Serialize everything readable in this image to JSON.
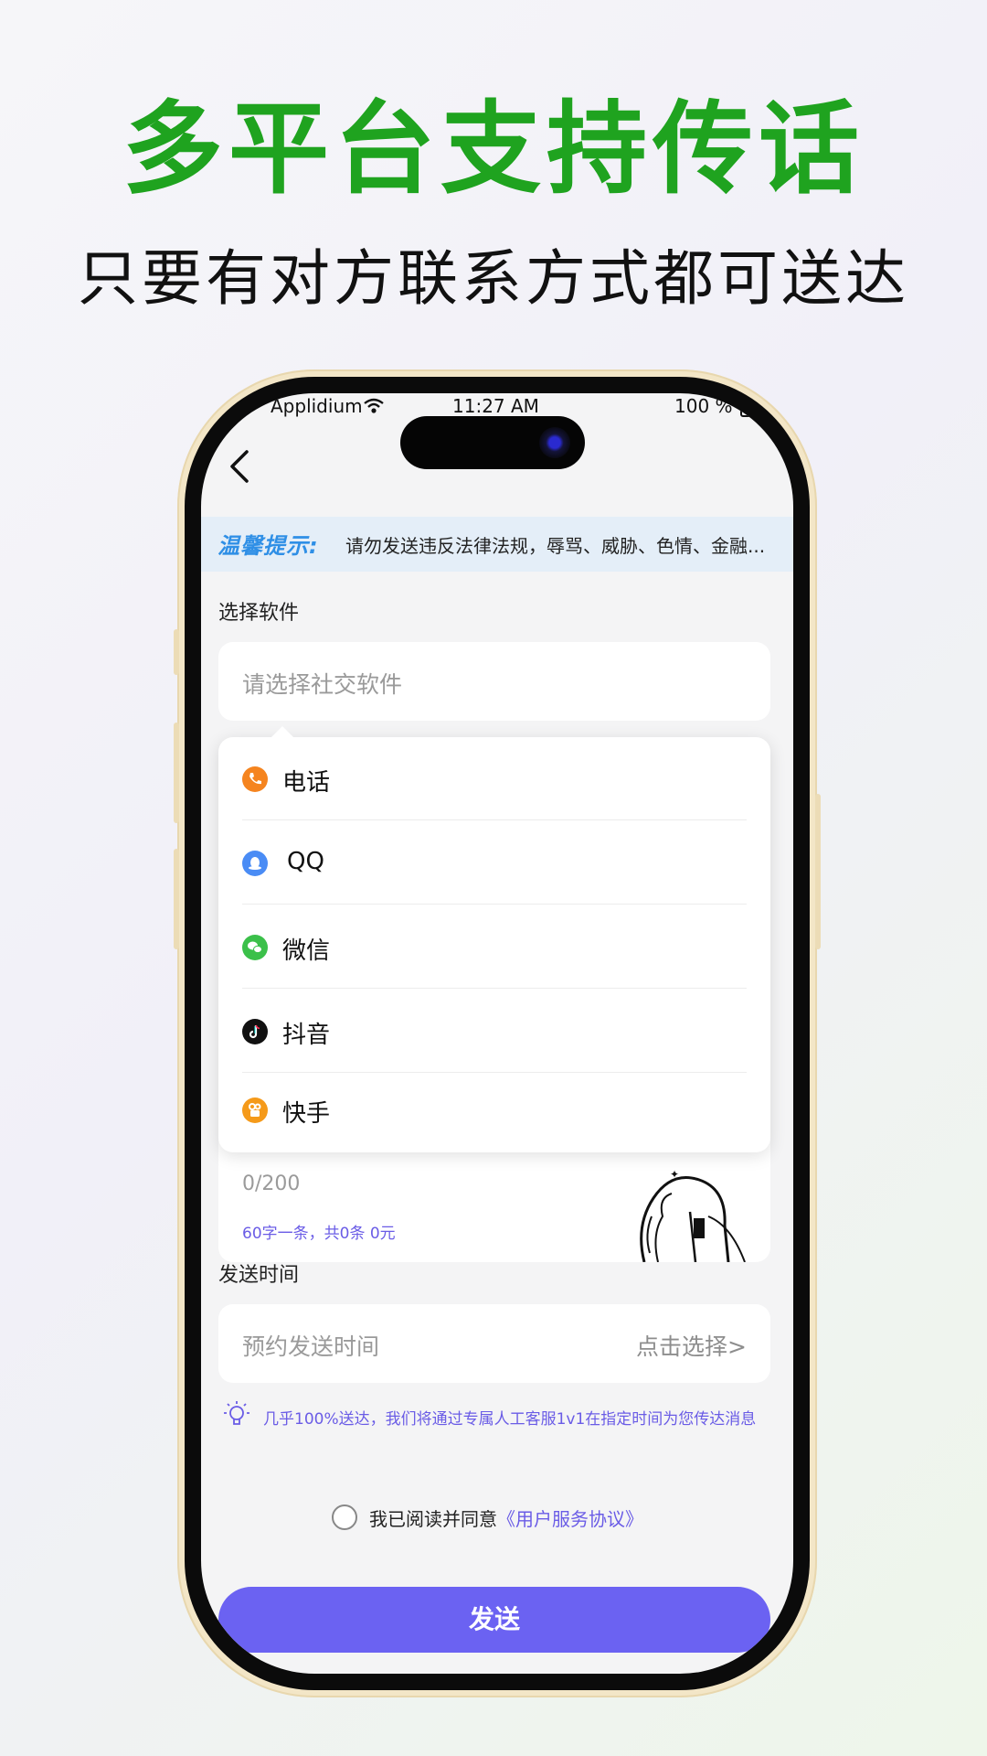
{
  "promo": {
    "headline": "多平台支持传话",
    "subline": "只要有对方联系方式都可送达"
  },
  "status_bar": {
    "carrier": "Applidium",
    "time": "11:27 AM",
    "battery": "100 %"
  },
  "notice": {
    "label": "温馨提示:",
    "text": "请勿发送违反法律法规，辱骂、威胁、色情、金融..."
  },
  "software": {
    "label": "选择软件",
    "placeholder": "请选择社交软件",
    "options": [
      {
        "label": "电话",
        "icon": "phone-icon",
        "color": "#f5841f"
      },
      {
        "label": "QQ",
        "icon": "qq-icon",
        "color": "#4a8cf5"
      },
      {
        "label": "微信",
        "icon": "wechat-icon",
        "color": "#3bc04a"
      },
      {
        "label": "抖音",
        "icon": "douyin-icon",
        "color": "#111111"
      },
      {
        "label": "快手",
        "icon": "kuaishou-icon",
        "color": "#f59a1a"
      }
    ]
  },
  "message": {
    "counter": "0/200",
    "price_note": "60字一条，共0条  0元"
  },
  "send_time": {
    "label": "发送时间",
    "placeholder": "预约发送时间",
    "select_link": "点击选择>"
  },
  "tip": {
    "text": "几乎100%送达，我们将通过专属人工客服1v1在指定时间为您传达消息"
  },
  "agreement": {
    "prefix": "我已阅读并同意",
    "link": "《用户服务协议》"
  },
  "send_button": {
    "label": "发送"
  },
  "colors": {
    "headline": "#1fa31f",
    "accent": "#6b62f2",
    "notice_bg": "#e4eef8",
    "notice_label": "#2f8fe6"
  }
}
